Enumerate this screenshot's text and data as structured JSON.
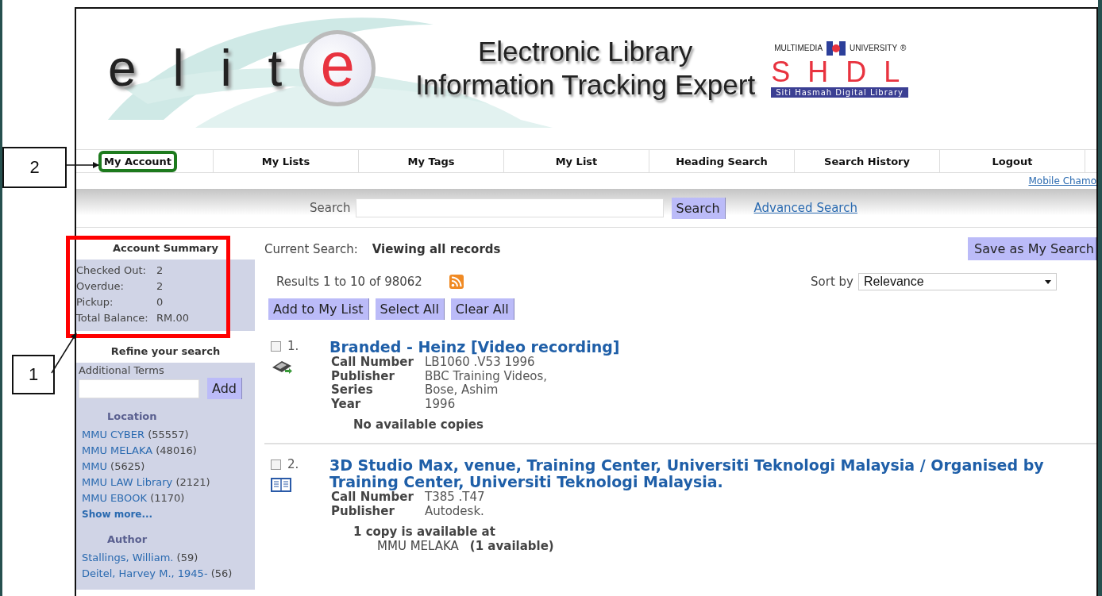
{
  "callouts": [
    {
      "number": "2"
    },
    {
      "number": "1"
    }
  ],
  "header": {
    "logo_letters": "e l i t",
    "logo_big_letter": "e",
    "title_line_1": "Electronic Library",
    "title_line_2": "Information Tracking Expert",
    "university_left": "MULTIMEDIA",
    "university_right": "UNIVERSITY",
    "registered_mark": "®",
    "shdl": "S H D L",
    "shdl_subtitle": "Siti Hasmah Digital Library"
  },
  "nav": [
    {
      "label": "My Account",
      "highlighted": true
    },
    {
      "label": "My Lists",
      "highlighted": false
    },
    {
      "label": "My Tags",
      "highlighted": false
    },
    {
      "label": "My List",
      "highlighted": false
    },
    {
      "label": "Heading Search",
      "highlighted": false
    },
    {
      "label": "Search History",
      "highlighted": false
    },
    {
      "label": "Logout",
      "highlighted": false
    }
  ],
  "mobile_link": "Mobile Chamo",
  "search": {
    "label": "Search",
    "button": "Search",
    "advanced_link": "Advanced Search"
  },
  "account_summary": {
    "title": "Account Summary",
    "highlighted": true,
    "rows": [
      {
        "label": "Checked Out:",
        "value": "2"
      },
      {
        "label": "Overdue:",
        "value": "2"
      },
      {
        "label": "Pickup:",
        "value": "0"
      },
      {
        "label": "Total Balance:",
        "value": "RM.00"
      }
    ]
  },
  "refine": {
    "title": "Refine your search",
    "additional_terms_label": "Additional Terms",
    "add_button": "Add",
    "facets": [
      {
        "heading": "Location",
        "show_more": "Show more...",
        "items": [
          {
            "name": "MMU CYBER",
            "count": "(55557)"
          },
          {
            "name": "MMU MELAKA",
            "count": "(48016)"
          },
          {
            "name": "MMU",
            "count": "(5625)"
          },
          {
            "name": "MMU LAW Library",
            "count": "(2121)"
          },
          {
            "name": "MMU EBOOK",
            "count": "(1170)"
          }
        ]
      },
      {
        "heading": "Author",
        "items": [
          {
            "name": "Stallings, William.",
            "count": "(59)"
          },
          {
            "name": "Deitel, Harvey M., 1945-",
            "count": "(56)"
          }
        ]
      }
    ]
  },
  "results": {
    "current_search_label": "Current Search:",
    "current_search_value": "Viewing all records",
    "save_button": "Save as My Search",
    "summary": "Results 1 to 10 of 98062",
    "sort_label": "Sort by",
    "sort_value": "Relevance",
    "actions": [
      "Add to My List",
      "Select All",
      "Clear All"
    ],
    "records": [
      {
        "number": "1.",
        "checked": false,
        "kind": "video",
        "title": "Branded - Heinz [Video recording]",
        "fields": [
          {
            "label": "Call Number",
            "value": "LB1060 .V53 1996"
          },
          {
            "label": "Publisher",
            "value": "BBC Training Videos,"
          },
          {
            "label": "Series",
            "value": "Bose, Ashim"
          },
          {
            "label": "Year",
            "value": "1996"
          }
        ],
        "availability": "No available copies"
      },
      {
        "number": "2.",
        "checked": false,
        "kind": "book",
        "title": "3D Studio Max, venue, Training Center, Universiti Teknologi Malaysia / Organised by Training Center, Universiti Teknologi Malaysia.",
        "fields": [
          {
            "label": "Call Number",
            "value": "T385 .T47"
          },
          {
            "label": "Publisher",
            "value": "Autodesk."
          }
        ],
        "availability": "1 copy is available at",
        "location": "MMU MELAKA",
        "location_count": "(1 available)"
      }
    ]
  }
}
